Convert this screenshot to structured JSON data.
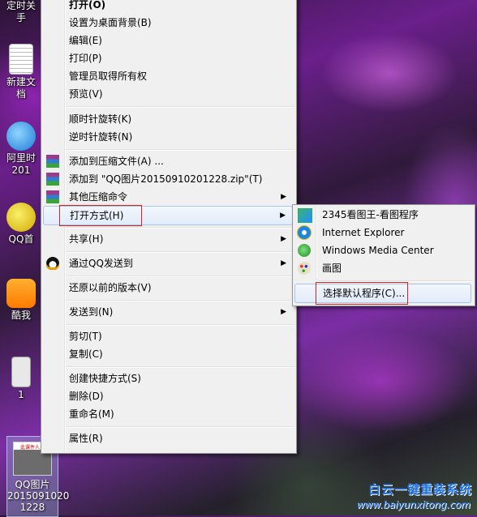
{
  "desktop": {
    "icons": [
      {
        "label": "定时关\n手"
      },
      {
        "label": "新建文\n档"
      },
      {
        "label": "阿里时\n201"
      },
      {
        "label": "QQ首"
      },
      {
        "label": "酷我"
      },
      {
        "label": "1"
      }
    ],
    "selected_file": {
      "label": "QQ图片\n2015091020\n1228",
      "thumb_text": "此课件人员"
    }
  },
  "context_menu": {
    "items": [
      {
        "label": "打开(O)"
      },
      {
        "label": "设置为桌面背景(B)"
      },
      {
        "label": "编辑(E)"
      },
      {
        "label": "打印(P)"
      },
      {
        "label": "管理员取得所有权"
      },
      {
        "label": "预览(V)"
      },
      {
        "label": "顺时针旋转(K)"
      },
      {
        "label": "逆时针旋转(N)"
      },
      {
        "label": "添加到压缩文件(A) ..."
      },
      {
        "label": "添加到 \"QQ图片20150910201228.zip\"(T)"
      },
      {
        "label": "其他压缩命令"
      },
      {
        "label": "打开方式(H)"
      },
      {
        "label": "共享(H)"
      },
      {
        "label": "通过QQ发送到"
      },
      {
        "label": "还原以前的版本(V)"
      },
      {
        "label": "发送到(N)"
      },
      {
        "label": "剪切(T)"
      },
      {
        "label": "复制(C)"
      },
      {
        "label": "创建快捷方式(S)"
      },
      {
        "label": "删除(D)"
      },
      {
        "label": "重命名(M)"
      },
      {
        "label": "属性(R)"
      }
    ]
  },
  "open_with_submenu": {
    "items": [
      {
        "label": "2345看图王-看图程序",
        "icon": "image-viewer-icon"
      },
      {
        "label": "Internet Explorer",
        "icon": "internet-explorer-icon"
      },
      {
        "label": "Windows Media Center",
        "icon": "windows-media-center-icon"
      },
      {
        "label": "画图",
        "icon": "paint-icon"
      },
      {
        "label": "选择默认程序(C)..."
      }
    ]
  },
  "watermark": {
    "brand": "白云一键重装系统",
    "url": "www.baiyunxitong.com"
  },
  "colors": {
    "highlight_border": "#e02020",
    "menu_bg": "#f0f0f0",
    "hover_border": "#a8c4e8"
  }
}
